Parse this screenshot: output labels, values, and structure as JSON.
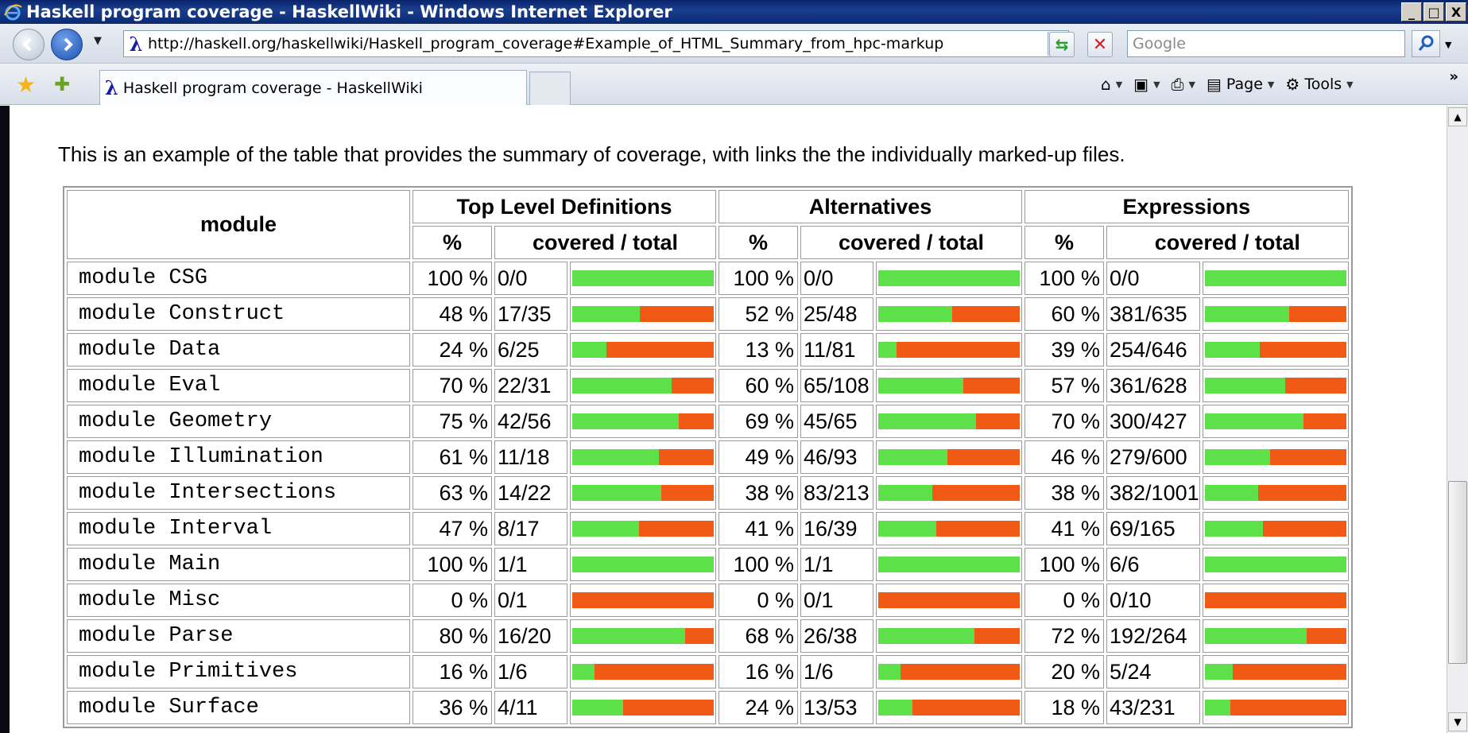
{
  "window": {
    "title": "Haskell program coverage - HaskellWiki - Windows Internet Explorer",
    "min": "_",
    "max": "□",
    "close": "X"
  },
  "address": {
    "url": "http://haskell.org/haskellwiki/Haskell_program_coverage#Example_of_HTML_Summary_from_hpc-markup",
    "search_placeholder": "Google"
  },
  "tabs": {
    "active_label": "Haskell program coverage - HaskellWiki"
  },
  "commands": {
    "page": "Page",
    "tools": "Tools"
  },
  "page": {
    "intro": "This is an example of the table that provides the summary of coverage, with links the the individually marked-up files."
  },
  "table": {
    "header_module": "module",
    "groups": [
      "Top Level Definitions",
      "Alternatives",
      "Expressions"
    ],
    "sub_pct": "%",
    "sub_ct": "covered / total",
    "rows": [
      {
        "module": "module CSG",
        "tld": {
          "pct": "100 %",
          "ct": "0/0",
          "f": 1.0
        },
        "alt": {
          "pct": "100 %",
          "ct": "0/0",
          "f": 1.0
        },
        "exp": {
          "pct": "100 %",
          "ct": "0/0",
          "f": 1.0
        }
      },
      {
        "module": "module Construct",
        "tld": {
          "pct": "48 %",
          "ct": "17/35",
          "f": 0.48
        },
        "alt": {
          "pct": "52 %",
          "ct": "25/48",
          "f": 0.52
        },
        "exp": {
          "pct": "60 %",
          "ct": "381/635",
          "f": 0.6
        }
      },
      {
        "module": "module Data",
        "tld": {
          "pct": "24 %",
          "ct": "6/25",
          "f": 0.24
        },
        "alt": {
          "pct": "13 %",
          "ct": "11/81",
          "f": 0.13
        },
        "exp": {
          "pct": "39 %",
          "ct": "254/646",
          "f": 0.39
        }
      },
      {
        "module": "module Eval",
        "tld": {
          "pct": "70 %",
          "ct": "22/31",
          "f": 0.7
        },
        "alt": {
          "pct": "60 %",
          "ct": "65/108",
          "f": 0.6
        },
        "exp": {
          "pct": "57 %",
          "ct": "361/628",
          "f": 0.57
        }
      },
      {
        "module": "module Geometry",
        "tld": {
          "pct": "75 %",
          "ct": "42/56",
          "f": 0.75
        },
        "alt": {
          "pct": "69 %",
          "ct": "45/65",
          "f": 0.69
        },
        "exp": {
          "pct": "70 %",
          "ct": "300/427",
          "f": 0.7
        }
      },
      {
        "module": "module Illumination",
        "tld": {
          "pct": "61 %",
          "ct": "11/18",
          "f": 0.61
        },
        "alt": {
          "pct": "49 %",
          "ct": "46/93",
          "f": 0.49
        },
        "exp": {
          "pct": "46 %",
          "ct": "279/600",
          "f": 0.46
        }
      },
      {
        "module": "module Intersections",
        "tld": {
          "pct": "63 %",
          "ct": "14/22",
          "f": 0.63
        },
        "alt": {
          "pct": "38 %",
          "ct": "83/213",
          "f": 0.38
        },
        "exp": {
          "pct": "38 %",
          "ct": "382/1001",
          "f": 0.38
        }
      },
      {
        "module": "module Interval",
        "tld": {
          "pct": "47 %",
          "ct": "8/17",
          "f": 0.47
        },
        "alt": {
          "pct": "41 %",
          "ct": "16/39",
          "f": 0.41
        },
        "exp": {
          "pct": "41 %",
          "ct": "69/165",
          "f": 0.41
        }
      },
      {
        "module": "module Main",
        "tld": {
          "pct": "100 %",
          "ct": "1/1",
          "f": 1.0
        },
        "alt": {
          "pct": "100 %",
          "ct": "1/1",
          "f": 1.0
        },
        "exp": {
          "pct": "100 %",
          "ct": "6/6",
          "f": 1.0
        }
      },
      {
        "module": "module Misc",
        "tld": {
          "pct": "0 %",
          "ct": "0/1",
          "f": 0.0
        },
        "alt": {
          "pct": "0 %",
          "ct": "0/1",
          "f": 0.0
        },
        "exp": {
          "pct": "0 %",
          "ct": "0/10",
          "f": 0.0
        }
      },
      {
        "module": "module Parse",
        "tld": {
          "pct": "80 %",
          "ct": "16/20",
          "f": 0.8
        },
        "alt": {
          "pct": "68 %",
          "ct": "26/38",
          "f": 0.68
        },
        "exp": {
          "pct": "72 %",
          "ct": "192/264",
          "f": 0.72
        }
      },
      {
        "module": "module Primitives",
        "tld": {
          "pct": "16 %",
          "ct": "1/6",
          "f": 0.16
        },
        "alt": {
          "pct": "16 %",
          "ct": "1/6",
          "f": 0.16
        },
        "exp": {
          "pct": "20 %",
          "ct": "5/24",
          "f": 0.2
        }
      },
      {
        "module": "module Surface",
        "tld": {
          "pct": "36 %",
          "ct": "4/11",
          "f": 0.36
        },
        "alt": {
          "pct": "24 %",
          "ct": "13/53",
          "f": 0.24
        },
        "exp": {
          "pct": "18 %",
          "ct": "43/231",
          "f": 0.18
        }
      }
    ]
  },
  "colors": {
    "covered": "#5ee04a",
    "uncovered": "#f05a14"
  }
}
